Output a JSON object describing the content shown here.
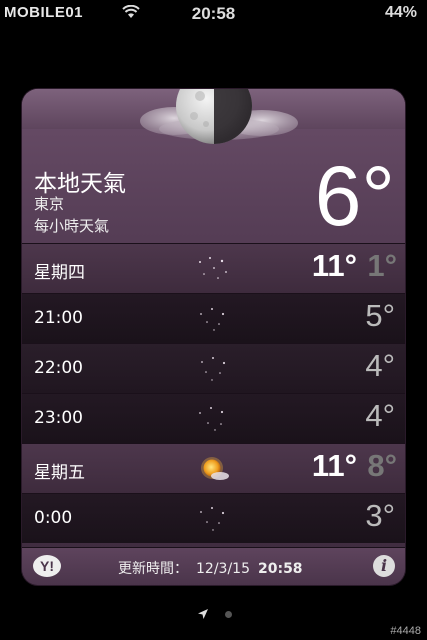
{
  "status_bar": {
    "carrier": "MOBILE01",
    "time": "20:58",
    "battery": "44%"
  },
  "header": {
    "title": "本地天氣",
    "city": "東京",
    "subtitle": "每小時天氣",
    "current_temp": "6°",
    "condition_icon": "half-moon-cloudy-icon"
  },
  "rows": [
    {
      "type": "day",
      "label": "星期四",
      "icon": "clear-night-stars-icon",
      "high": "11°",
      "low": "1°"
    },
    {
      "type": "hour",
      "label": "21:00",
      "icon": "clear-night-stars-icon",
      "temp": "5°"
    },
    {
      "type": "hour",
      "label": "22:00",
      "icon": "clear-night-stars-icon",
      "temp": "4°"
    },
    {
      "type": "hour",
      "label": "23:00",
      "icon": "clear-night-stars-icon",
      "temp": "4°"
    },
    {
      "type": "day",
      "label": "星期五",
      "icon": "sun-cloud-icon",
      "high": "11°",
      "low": "8°"
    },
    {
      "type": "hour",
      "label": "0:00",
      "icon": "clear-night-stars-icon",
      "temp": "3°"
    }
  ],
  "footer": {
    "updated_label": "更新時間：",
    "updated_date": "12/3/15",
    "updated_time": "20:58",
    "info_label": "i",
    "yahoo_logo": "Y!"
  },
  "watermark": "#4448",
  "colors": {
    "card_top": "#6a4e69",
    "card_bottom": "#3e2b3e",
    "hour_row": "#1f151f",
    "low_temp": "#777777"
  }
}
